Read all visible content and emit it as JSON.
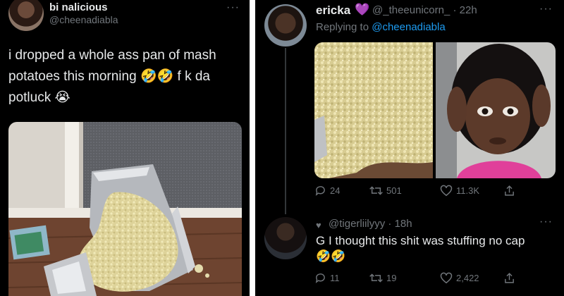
{
  "left_tweet": {
    "display_name": "bi  nalicious",
    "handle": "@cheenadiabla",
    "more_label": "···",
    "text": "i dropped a whole ass pan of mash potatoes this morning 🤣🤣 f      k da potluck 😭",
    "photo": {
      "description_icon": "spilled-mashed-potatoes-photo"
    }
  },
  "right_tweet": {
    "display_name": "ericka",
    "badge_emoji": "💜",
    "handle": "@_theeunicorn_",
    "time": "· 22h",
    "more_label": "···",
    "replying_prefix": "Replying to ",
    "replying_handle": "@cheenadiabla",
    "actions": {
      "replies": "24",
      "retweets": "501",
      "likes": "11.3K"
    }
  },
  "sub_reply": {
    "liked_icon": "♥",
    "handle": "@tigerliilyyy",
    "time": "· 18h",
    "more_label": "···",
    "text": "G I thought this shit was stuffing no cap",
    "emoji": "🤣🤣",
    "actions": {
      "replies": "11",
      "retweets": "19",
      "likes": "2,422"
    }
  },
  "colors": {
    "background": "#000000",
    "primary_text": "#e7e9ea",
    "secondary_text": "#71767b",
    "link": "#1d9bf0"
  }
}
